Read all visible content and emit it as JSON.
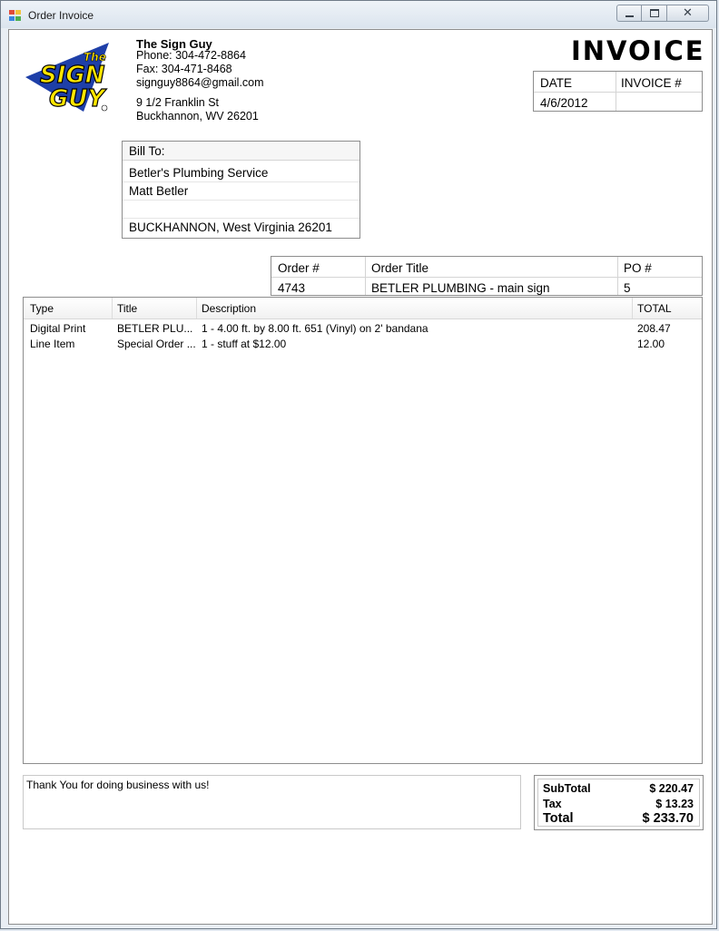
{
  "window": {
    "title": "Order Invoice"
  },
  "company": {
    "logo_text_top": "The",
    "logo_text_main": "SIGN",
    "logo_text_bottom": "GUY",
    "name": "The Sign Guy",
    "phone": "Phone: 304-472-8864",
    "fax": "Fax: 304-471-8468",
    "email": "signguy8864@gmail.com",
    "address1": "9 1/2 Franklin St",
    "address2": "Buckhannon, WV 26201"
  },
  "invoice": {
    "heading": "INVOICE",
    "date_label": "DATE",
    "number_label": "INVOICE #",
    "date_value": "4/6/2012",
    "number_value": ""
  },
  "bill_to": {
    "label": "Bill To:",
    "line1": "Betler's Plumbing Service",
    "line2": "Matt Betler",
    "line3": "",
    "line4": "BUCKHANNON, West Virginia 26201"
  },
  "order": {
    "headers": [
      "Order #",
      "Order Title",
      "PO #"
    ],
    "values": [
      "4743",
      "BETLER PLUMBING - main sign",
      "5"
    ]
  },
  "items": {
    "headers": [
      "Type",
      "Title",
      "Description",
      "TOTAL"
    ],
    "rows": [
      [
        "Digital Print",
        "BETLER PLU...",
        "1 -  4.00 ft. by 8.00 ft. 651 (Vinyl) on 2' bandana",
        "208.47"
      ],
      [
        "Line Item",
        "Special Order  ...",
        "1 - stuff at $12.00",
        "12.00"
      ]
    ]
  },
  "notes": {
    "text": "Thank You for doing business with us!"
  },
  "totals": {
    "subtotal_label": "SubTotal",
    "subtotal_value": "$ 220.47",
    "tax_label": "Tax",
    "tax_value": "$ 13.23",
    "total_label": "Total",
    "total_value": "$ 233.70"
  },
  "colors": {
    "logo_blue": "#1e3fa8",
    "logo_yellow": "#ffe600"
  }
}
